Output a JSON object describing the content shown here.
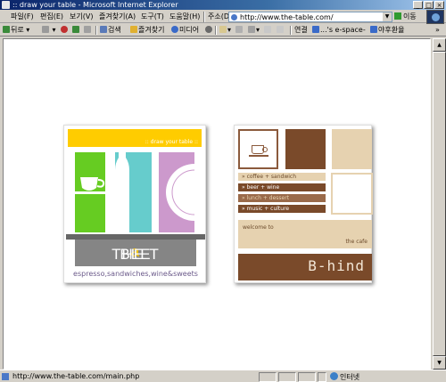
{
  "window": {
    "title": ":: draw your table - Microsoft Internet Explorer"
  },
  "menu": [
    "파일(F)",
    "편집(E)",
    "보기(V)",
    "즐겨찾기(A)",
    "도구(T)",
    "도움말(H)"
  ],
  "address": {
    "label": "주소(D)",
    "url": "http://www.the-table.com/",
    "go_label": "이동"
  },
  "toolbar": {
    "back": "뒤로",
    "search": "검색",
    "favorites": "즐겨찾기",
    "media": "미디어",
    "links_label": "연결",
    "link1": "...'s e-space-",
    "link2": "야후환율",
    "more": "»"
  },
  "card_left": {
    "yellow_text": ":: draw your table ::",
    "name_pre": "THE T",
    "name_a": "a",
    "name_post": "BLE",
    "tagline": "espresso,sandwiches,wine&sweets"
  },
  "card_right": {
    "menu": [
      "» coffee + sandwich",
      "» beer + wine",
      "» lunch + dessert",
      "» music + culture"
    ],
    "welcome_line1": "welcome to",
    "welcome_line2": "the cafe",
    "behind": "B-hind"
  },
  "status": {
    "text": "http://www.the-table.com/main.php",
    "zone": "인터넷"
  },
  "colors": {
    "yellow": "#ffcc00",
    "green": "#66cc22",
    "teal": "#66cccc",
    "lilac": "#cc99cc",
    "brown": "#7a4a2a",
    "tan": "#e6d2b0",
    "gray": "#858585"
  }
}
